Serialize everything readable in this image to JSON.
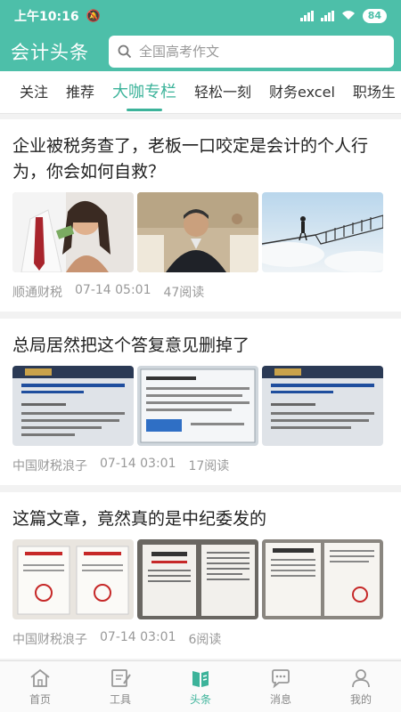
{
  "status": {
    "time": "上午10:16",
    "battery": "84"
  },
  "header": {
    "title": "会计头条",
    "search_placeholder": "全国高考作文"
  },
  "tabs": [
    {
      "label": "关注"
    },
    {
      "label": "推荐"
    },
    {
      "label": "大咖专栏",
      "active": true
    },
    {
      "label": "轻松一刻"
    },
    {
      "label": "财务excel"
    },
    {
      "label": "职场生"
    }
  ],
  "articles": [
    {
      "title": "企业被税务查了，老板一口咬定是会计的个人行为，你会如何自救？",
      "source": "顺通财税",
      "time": "07-14 05:01",
      "reads": "47阅读"
    },
    {
      "title": "总局居然把这个答复意见删掉了",
      "source": "中国财税浪子",
      "time": "07-14 03:01",
      "reads": "17阅读"
    },
    {
      "title": "这篇文章，竟然真的是中纪委发的",
      "source": "中国财税浪子",
      "time": "07-14 03:01",
      "reads": "6阅读"
    }
  ],
  "bottom_nav": [
    {
      "label": "首页",
      "icon": "home-icon"
    },
    {
      "label": "工具",
      "icon": "tools-icon"
    },
    {
      "label": "头条",
      "icon": "headline-icon",
      "active": true
    },
    {
      "label": "消息",
      "icon": "message-icon"
    },
    {
      "label": "我的",
      "icon": "profile-icon"
    }
  ],
  "colors": {
    "brand": "#4dbfa9",
    "accent": "#3cb39a",
    "meta": "#999999"
  }
}
